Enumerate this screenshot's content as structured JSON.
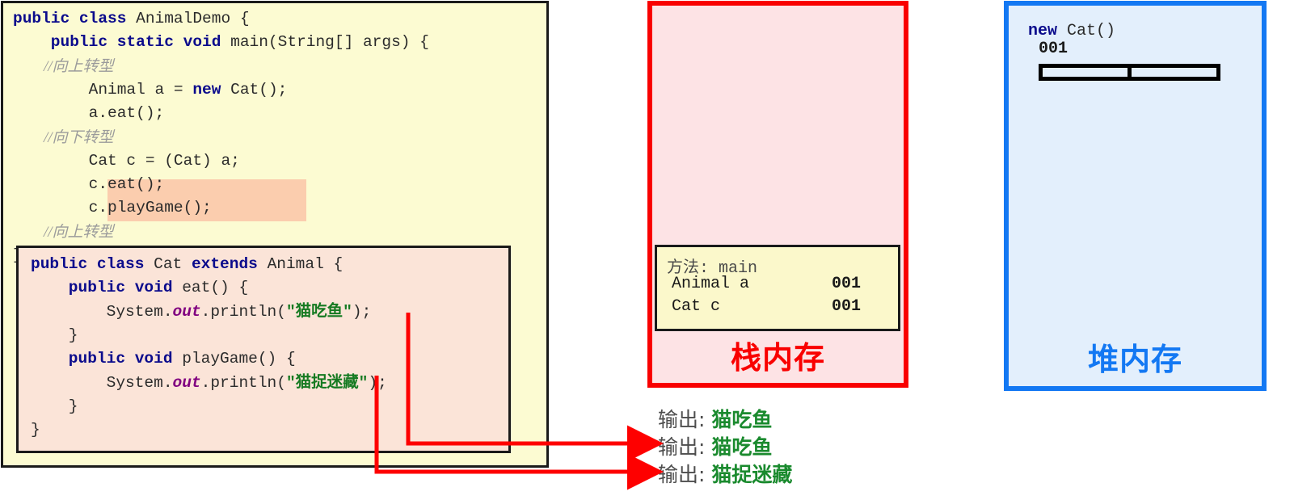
{
  "code_panel": {
    "outer_lines": [
      {
        "id": "l1",
        "segments": [
          {
            "t": "public class ",
            "c": "kw"
          },
          {
            "t": "AnimalDemo {",
            "c": ""
          }
        ]
      },
      {
        "id": "l2",
        "segments": [
          {
            "t": "    public static void ",
            "c": "kw"
          },
          {
            "t": "main(String[] args) {",
            "c": ""
          }
        ]
      },
      {
        "id": "l3",
        "segments": [
          {
            "t": "        //向上转型",
            "c": "cmt"
          }
        ]
      },
      {
        "id": "l4",
        "segments": [
          {
            "t": "        Animal a = ",
            "c": ""
          },
          {
            "t": "new ",
            "c": "kw"
          },
          {
            "t": "Cat();",
            "c": ""
          }
        ]
      },
      {
        "id": "l5",
        "segments": [
          {
            "t": "        a.eat();",
            "c": ""
          }
        ]
      },
      {
        "id": "l6",
        "segments": [
          {
            "t": "        //向下转型",
            "c": "cmt"
          }
        ]
      },
      {
        "id": "l7",
        "segments": [
          {
            "t": "        Cat c = (Cat) a;",
            "c": ""
          }
        ]
      },
      {
        "id": "l8",
        "segments": [
          {
            "t": "        c.eat();",
            "c": ""
          }
        ]
      },
      {
        "id": "l9",
        "segments": [
          {
            "t": "        c.playGame();",
            "c": ""
          }
        ]
      },
      {
        "id": "l10",
        "segments": [
          {
            "t": "        //向上转型",
            "c": "cmt"
          }
        ]
      },
      {
        "id": "l11",
        "segments": [
          {
            "t": "}",
            "c": ""
          }
        ]
      }
    ],
    "cat_class_lines": [
      {
        "id": "c1",
        "segments": [
          {
            "t": "public class ",
            "c": "kw"
          },
          {
            "t": "Cat ",
            "c": ""
          },
          {
            "t": "extends ",
            "c": "kw"
          },
          {
            "t": "Animal {",
            "c": ""
          }
        ]
      },
      {
        "id": "c2",
        "segments": [
          {
            "t": "    public void ",
            "c": "kw"
          },
          {
            "t": "eat() {",
            "c": ""
          }
        ]
      },
      {
        "id": "c3",
        "segments": [
          {
            "t": "        System.",
            "c": ""
          },
          {
            "t": "out",
            "c": "out"
          },
          {
            "t": ".println(",
            "c": ""
          },
          {
            "t": "\"猫吃鱼\"",
            "c": "str"
          },
          {
            "t": ");",
            "c": ""
          }
        ]
      },
      {
        "id": "c4",
        "segments": [
          {
            "t": "    }",
            "c": ""
          }
        ]
      },
      {
        "id": "c5",
        "segments": [
          {
            "t": "    public void ",
            "c": "kw"
          },
          {
            "t": "playGame() {",
            "c": ""
          }
        ]
      },
      {
        "id": "c6",
        "segments": [
          {
            "t": "        System.",
            "c": ""
          },
          {
            "t": "out",
            "c": "out"
          },
          {
            "t": ".println(",
            "c": ""
          },
          {
            "t": "\"猫捉迷藏\"",
            "c": "str"
          },
          {
            "t": ");",
            "c": ""
          }
        ]
      },
      {
        "id": "c7",
        "segments": [
          {
            "t": "    }",
            "c": ""
          }
        ]
      },
      {
        "id": "c8",
        "segments": [
          {
            "t": "}",
            "c": ""
          }
        ]
      }
    ],
    "highlighted_statements": [
      "c.eat();",
      "c.playGame();"
    ]
  },
  "stack": {
    "label": "栈内存",
    "label_color": "#f90000",
    "border_color": "#f90000",
    "background": "#fde3e5",
    "frame": {
      "title": "方法: main",
      "rows": [
        {
          "name": "Animal a",
          "address": "001"
        },
        {
          "name": "Cat c",
          "address": "001"
        }
      ]
    }
  },
  "heap": {
    "label": "堆内存",
    "label_color": "#1378f3",
    "border_color": "#1378f3",
    "background": "#e3effc",
    "object": {
      "new_keyword": "new",
      "type": "Cat()",
      "address": "001",
      "member_slots": 2
    }
  },
  "console": {
    "lines": [
      {
        "prefix": "输出: ",
        "value": "猫吃鱼",
        "has_arrow": false
      },
      {
        "prefix": "输出: ",
        "value": "猫吃鱼",
        "has_arrow": true
      },
      {
        "prefix": "输出: ",
        "value": "猫捉迷藏",
        "has_arrow": true
      }
    ],
    "value_color": "#1a8a2e"
  },
  "arrows": {
    "color": "#fe0000",
    "items": [
      {
        "name": "eat-output-arrow",
        "from": "\"猫吃鱼\" string literal",
        "to": "输出: 猫吃鱼 (second line)"
      },
      {
        "name": "playgame-output-arrow",
        "from": "\"猫捉迷藏\" string literal",
        "to": "输出: 猫捉迷藏 (third line)"
      }
    ]
  }
}
